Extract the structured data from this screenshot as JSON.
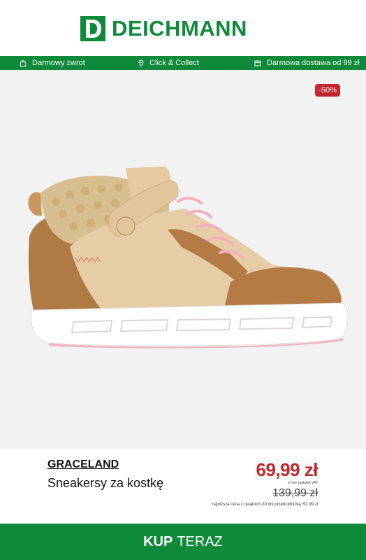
{
  "header": {
    "brand_logo": "DEICHMANN",
    "logo_icon": "deichmann-d-logo"
  },
  "usp_bar": {
    "items": [
      {
        "icon": "return-bag-icon",
        "label": "Darmowy zwrot"
      },
      {
        "icon": "location-pin-icon",
        "label": "Click & Collect"
      },
      {
        "icon": "delivery-box-icon",
        "label": "Darmowa dostawa od 99 zł"
      }
    ]
  },
  "product": {
    "discount_badge": "-50%",
    "brand": "GRACELAND",
    "name": "Sneakersy za kostkę",
    "price": "69,99 zł",
    "vat_note": "w tym podatek VAT",
    "old_price": "139,99 zł",
    "lowest_price_note": "najniższa cena z ostatnich 30 dni przed obniżką: 97,99 zł"
  },
  "cta": {
    "bold": "KUP",
    "rest": "TERAZ"
  },
  "colors": {
    "brand_green": "#0e8a3a",
    "sale_red": "#c3252d",
    "product_bg": "#f3f2f3"
  }
}
